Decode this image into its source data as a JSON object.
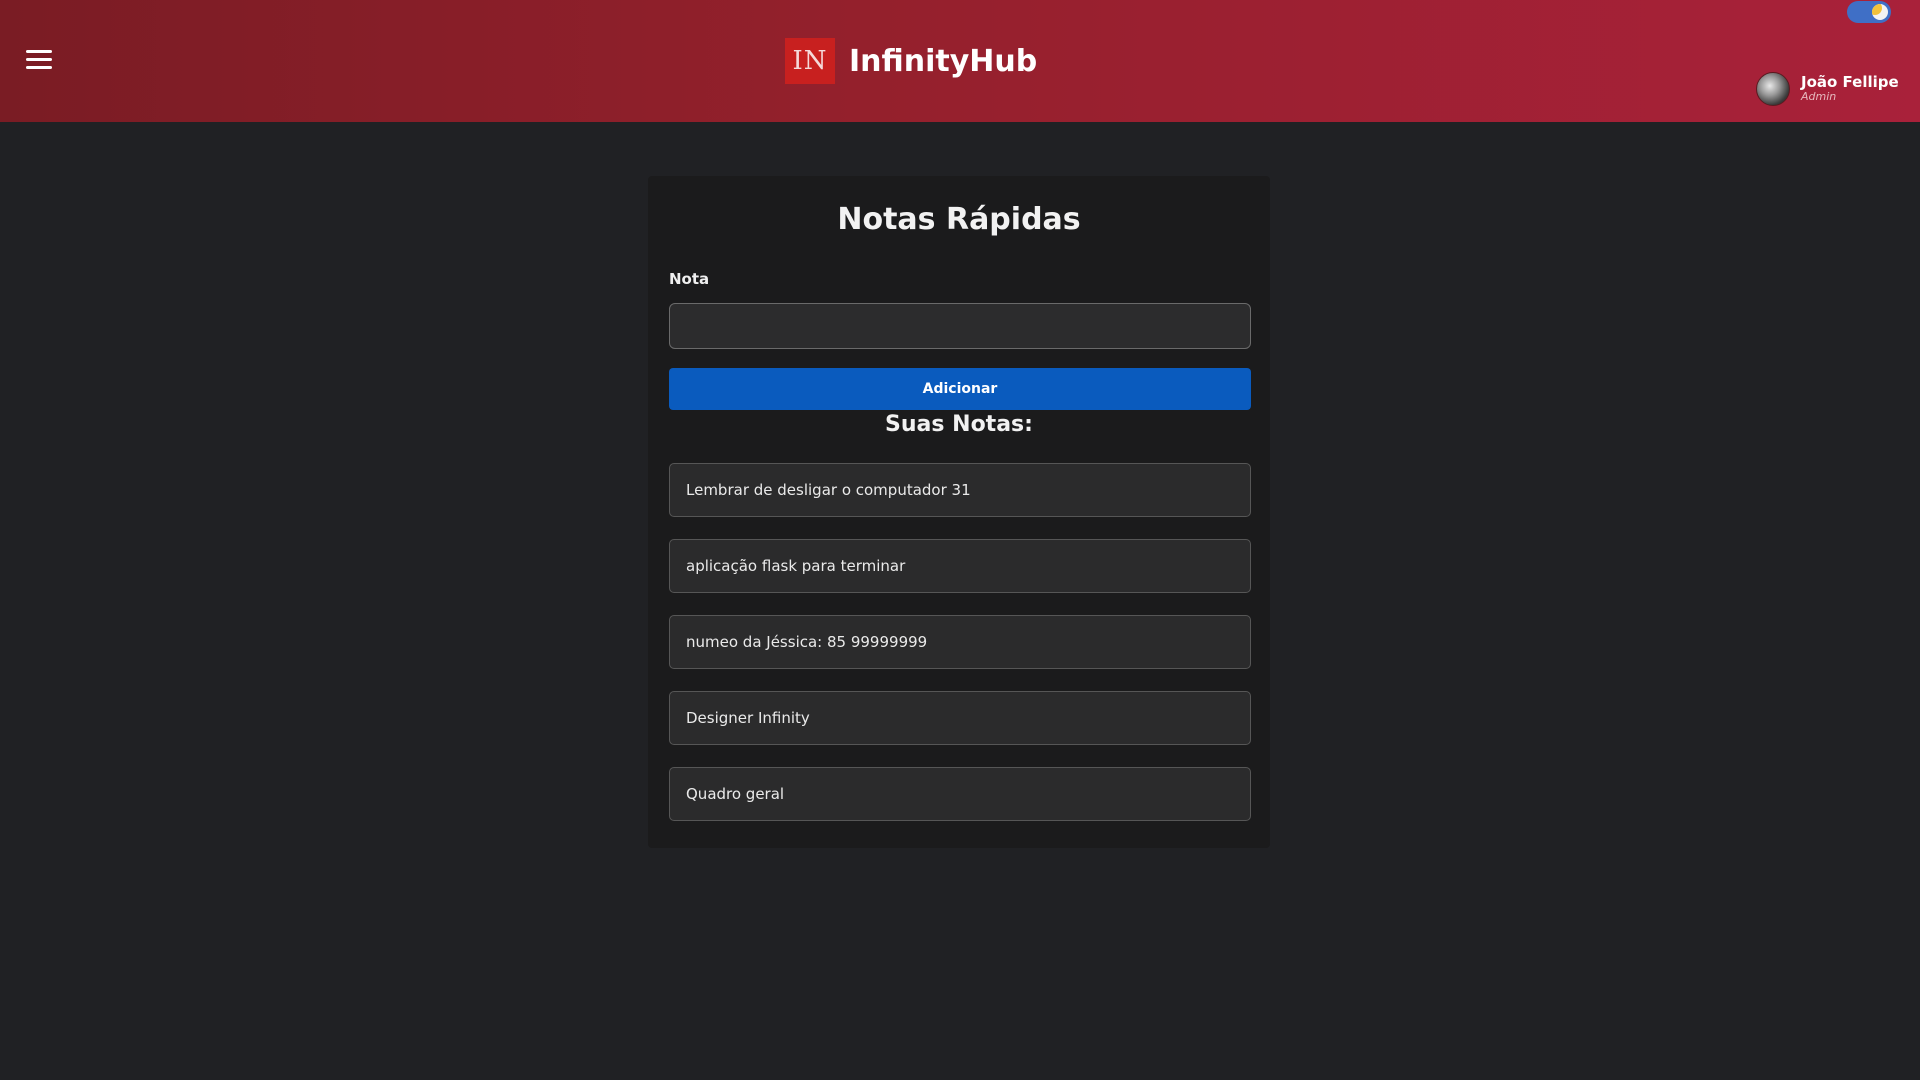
{
  "header": {
    "menu_icon": "hamburger-menu-icon",
    "logo_text": "IN",
    "brand_name": "InfinityHub",
    "theme_toggle_icon": "moon-sun-toggle-icon",
    "user": {
      "name": "João Fellipe",
      "role": "Admin"
    }
  },
  "main": {
    "title": "Notas Rápidas",
    "note_label": "Nota",
    "note_input_value": "",
    "add_button_label": "Adicionar",
    "notes_heading": "Suas Notas:",
    "notes": [
      "Lembrar de desligar o computador 31",
      "aplicação flask para terminar",
      "numeo da Jéssica: 85 99999999",
      "Designer Infinity",
      "Quadro geral"
    ]
  },
  "colors": {
    "header_gradient_start": "#7a1c24",
    "header_gradient_end": "#a9213a",
    "background": "#202124",
    "card": "#1b1b1c",
    "primary_button": "#0a5bbe",
    "logo_box": "#c8201f",
    "toggle": "#3f6fc6"
  }
}
